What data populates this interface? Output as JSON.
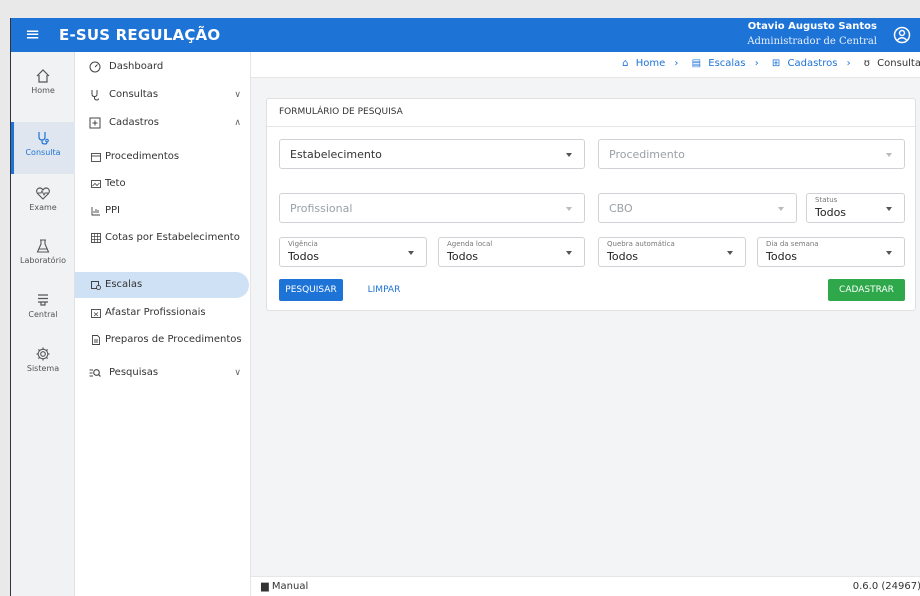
{
  "header": {
    "app_title": "E-SUS REGULAÇÃO",
    "user_name": "Otavio Augusto Santos",
    "user_role": "Administrador de Central",
    "brand_color": "#1e73d6"
  },
  "rail": {
    "items": [
      {
        "label": "Home",
        "icon": "home-icon"
      },
      {
        "label": "Consulta",
        "icon": "stethoscope-icon"
      },
      {
        "label": "Exame",
        "icon": "heart-pulse-icon"
      },
      {
        "label": "Laboratório",
        "icon": "flask-icon"
      },
      {
        "label": "Central",
        "icon": "server-icon"
      },
      {
        "label": "Sistema",
        "icon": "gear-icon"
      }
    ]
  },
  "sidebar": {
    "dashboard": "Dashboard",
    "consultas": "Consultas",
    "cadastros": "Cadastros",
    "sub": [
      "Procedimentos",
      "Teto",
      "PPI",
      "Cotas por Estabelecimento",
      "Escalas",
      "Afastar Profissionais",
      "Preparos de Procedimentos"
    ],
    "pesquisas": "Pesquisas"
  },
  "breadcrumb": {
    "home": "Home",
    "escalas": "Escalas",
    "cadastros": "Cadastros",
    "current": "Consulta"
  },
  "form": {
    "title": "FORMULÁRIO DE PESQUISA",
    "estabelecimento": "Estabelecimento",
    "procedimento": "Procedimento",
    "profissional": "Profissional",
    "cbo": "CBO",
    "status_label": "Status",
    "status_value": "Todos",
    "vigencia_label": "Vigência",
    "vigencia_value": "Todos",
    "agenda_label": "Agenda local",
    "agenda_value": "Todos",
    "quebra_label": "Quebra automática",
    "quebra_value": "Todos",
    "dia_label": "Dia da semana",
    "dia_value": "Todos",
    "btn_pesquisar": "PESQUISAR",
    "btn_limpar": "LIMPAR",
    "btn_cadastrar": "CADASTRAR"
  },
  "footer": {
    "manual": "Manual",
    "version": "0.6.0 (24967)"
  }
}
